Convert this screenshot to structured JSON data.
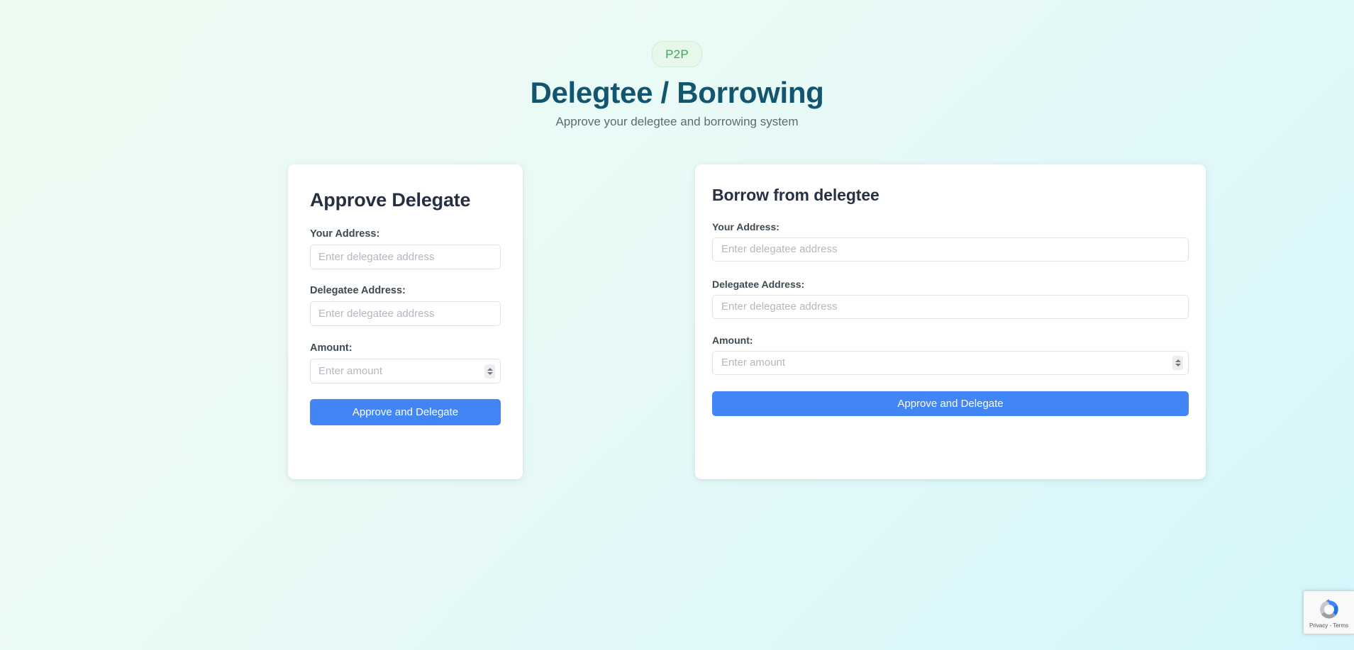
{
  "header": {
    "badge": "P2P",
    "title": "Delegtee / Borrowing",
    "subtitle": "Approve your delegtee and borrowing system"
  },
  "colors": {
    "accent_button": "#4285f4",
    "title": "#12556f",
    "badge_text": "#3aa860",
    "badge_bg": "#e7f8ea",
    "card_bg": "#ffffff",
    "background_from": "#eefbf2",
    "background_to": "#d4f6fa"
  },
  "left_card": {
    "title": "Approve Delegate",
    "fields": {
      "your_address_label": "Your Address:",
      "your_address_value": "",
      "your_address_placeholder": "Enter delegatee address",
      "delegatee_address_label": "Delegatee Address:",
      "delegatee_address_value": "",
      "delegatee_address_placeholder": "Enter delegatee address",
      "amount_label": "Amount:",
      "amount_value": "",
      "amount_placeholder": "Enter amount"
    },
    "submit_label": "Approve and Delegate"
  },
  "right_card": {
    "title": "Borrow from delegtee",
    "fields": {
      "your_address_label": "Your Address:",
      "your_address_value": "",
      "your_address_placeholder": "Enter delegatee address",
      "delegatee_address_label": "Delegatee Address:",
      "delegatee_address_value": "",
      "delegatee_address_placeholder": "Enter delegatee address",
      "amount_label": "Amount:",
      "amount_value": "",
      "amount_placeholder": "Enter amount"
    },
    "submit_label": "Approve and Delegate"
  },
  "recaptcha": {
    "text": "Privacy - Terms"
  }
}
